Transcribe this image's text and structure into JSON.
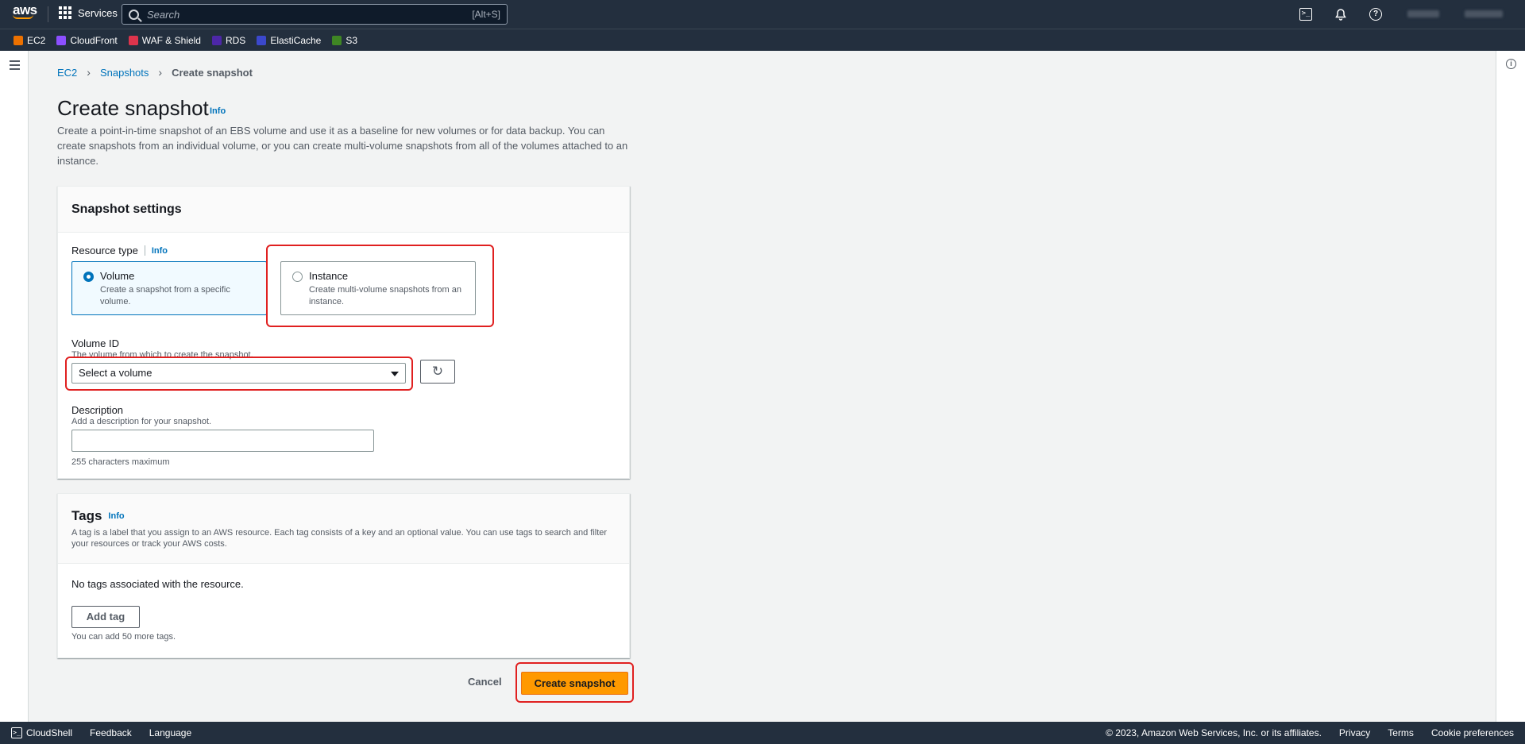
{
  "topnav": {
    "logo": "aws",
    "services_label": "Services",
    "search_placeholder": "Search",
    "search_shortcut": "[Alt+S]"
  },
  "favorites": [
    {
      "label": "EC2",
      "color": "#ed7100"
    },
    {
      "label": "CloudFront",
      "color": "#8c4fff"
    },
    {
      "label": "WAF & Shield",
      "color": "#dd344c"
    },
    {
      "label": "RDS",
      "color": "#4d27a8"
    },
    {
      "label": "ElastiCache",
      "color": "#3b48cc"
    },
    {
      "label": "S3",
      "color": "#3f8624"
    }
  ],
  "breadcrumb": {
    "items": [
      "EC2",
      "Snapshots"
    ],
    "current": "Create snapshot"
  },
  "page": {
    "title": "Create snapshot",
    "info": "Info",
    "description": "Create a point-in-time snapshot of an EBS volume and use it as a baseline for new volumes or for data backup. You can create snapshots from an individual volume, or you can create multi-volume snapshots from all of the volumes attached to an instance."
  },
  "settings": {
    "heading": "Snapshot settings",
    "resource_type_label": "Resource type",
    "info": "Info",
    "options": [
      {
        "title": "Volume",
        "desc": "Create a snapshot from a specific volume.",
        "selected": true
      },
      {
        "title": "Instance",
        "desc": "Create multi-volume snapshots from an instance.",
        "selected": false
      }
    ],
    "volume_id_label": "Volume ID",
    "volume_id_hint": "The volume from which to create the snapshot.",
    "volume_select_value": "Select a volume",
    "description_label": "Description",
    "description_hint": "Add a description for your snapshot.",
    "description_value": "",
    "description_limit": "255 characters maximum"
  },
  "tags": {
    "heading": "Tags",
    "info": "Info",
    "description": "A tag is a label that you assign to an AWS resource. Each tag consists of a key and an optional value. You can use tags to search and filter your resources or track your AWS costs.",
    "empty_text": "No tags associated with the resource.",
    "add_tag_label": "Add tag",
    "limit_hint": "You can add 50 more tags."
  },
  "actions": {
    "cancel_label": "Cancel",
    "submit_label": "Create snapshot"
  },
  "footer": {
    "cloudshell": "CloudShell",
    "feedback": "Feedback",
    "language": "Language",
    "copyright": "© 2023, Amazon Web Services, Inc. or its affiliates.",
    "privacy": "Privacy",
    "terms": "Terms",
    "cookie_prefs": "Cookie preferences"
  },
  "colors": {
    "nav_bg": "#232f3e",
    "link": "#0073bb",
    "primary": "#ff9900",
    "highlight": "#e02020"
  }
}
